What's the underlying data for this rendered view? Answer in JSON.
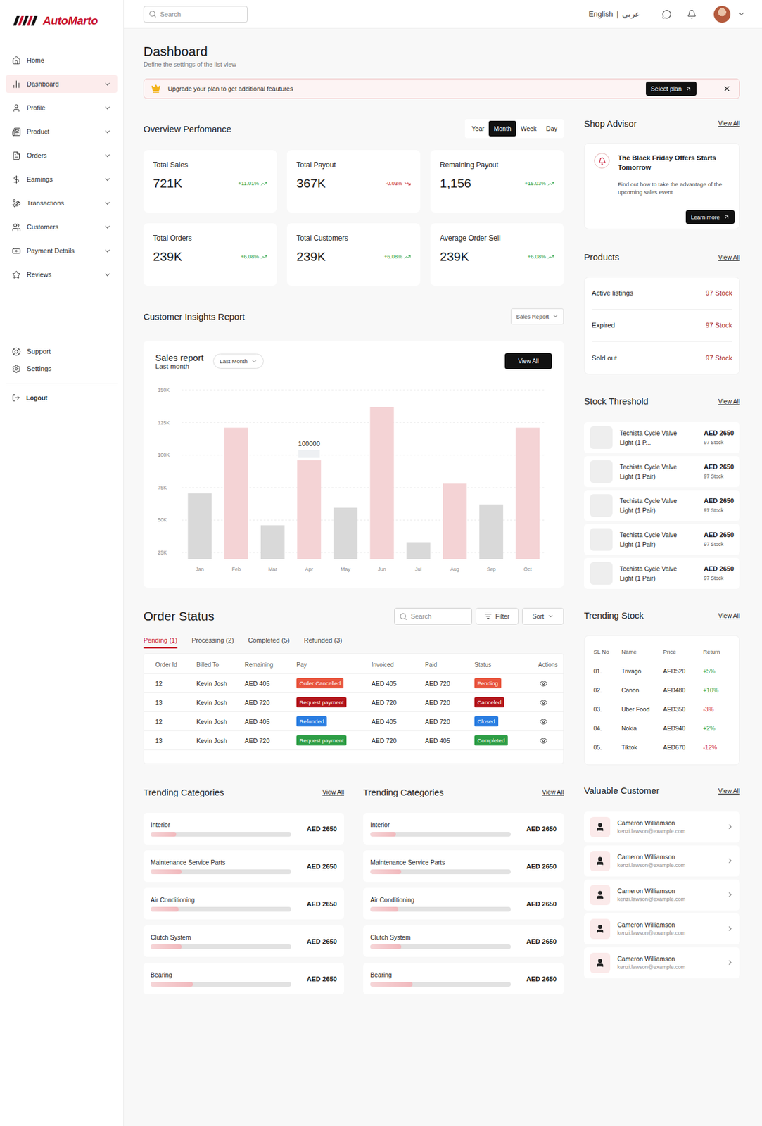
{
  "brand": {
    "name": "AutoMarto"
  },
  "topbar": {
    "search_placeholder": "Search",
    "language": "English",
    "separator": "|",
    "language_alt": "عربي"
  },
  "sidebar": {
    "items": [
      {
        "label": "Home",
        "expandable": false,
        "selected": false
      },
      {
        "label": "Dashboard",
        "expandable": true,
        "selected": true
      },
      {
        "label": "Profile",
        "expandable": true,
        "selected": false
      },
      {
        "label": "Product",
        "expandable": true,
        "selected": false
      },
      {
        "label": "Orders",
        "expandable": true,
        "selected": false
      },
      {
        "label": "Earnings",
        "expandable": true,
        "selected": false
      },
      {
        "label": "Transactions",
        "expandable": true,
        "selected": false
      },
      {
        "label": "Customers",
        "expandable": true,
        "selected": false
      },
      {
        "label": "Payment Details",
        "expandable": true,
        "selected": false
      },
      {
        "label": "Reviews",
        "expandable": true,
        "selected": false
      }
    ],
    "footer_items": [
      {
        "label": "Support"
      },
      {
        "label": "Settings"
      }
    ],
    "logout": "Logout"
  },
  "page": {
    "title": "Dashboard",
    "subtitle": "Define the settings of the list view"
  },
  "banner": {
    "text": "Upgrade your plan to get additional feautures",
    "button": "Select plan"
  },
  "overview": {
    "title": "Overview Perfomance",
    "periods": [
      {
        "label": "Year",
        "selected": false
      },
      {
        "label": "Month",
        "selected": true
      },
      {
        "label": "Week",
        "selected": false
      },
      {
        "label": "Day",
        "selected": false
      }
    ],
    "stats": [
      {
        "label": "Total Sales",
        "value": "721K",
        "change": "+11.01%",
        "kind": "up",
        "color": "#1f9d3a"
      },
      {
        "label": "Total Payout",
        "value": "367K",
        "change": "-0.03%",
        "kind": "down",
        "color": "#c0151b"
      },
      {
        "label": "Remaining Payout",
        "value": "1,156",
        "change": "+15.03%",
        "kind": "up",
        "color": "#1f9d3a"
      },
      {
        "label": "Total Orders",
        "value": "239K",
        "change": "+6.08%",
        "kind": "up",
        "color": "#1f9d3a"
      },
      {
        "label": "Total Customers",
        "value": "239K",
        "change": "+6.08%",
        "kind": "up",
        "color": "#1f9d3a"
      },
      {
        "label": "Average Order Sell",
        "value": "239K",
        "change": "+6.08%",
        "kind": "up",
        "color": "#1f9d3a"
      }
    ]
  },
  "insights": {
    "title": "Customer Insights Report",
    "dropdown": "Sales Report",
    "chart": {
      "title": "Sales report",
      "subtitle": "Last month",
      "range": "Last Month",
      "button": "View All",
      "y_ticks": [
        {
          "label": "150K",
          "value": 150000
        },
        {
          "label": "125K",
          "value": 125000
        },
        {
          "label": "100K",
          "value": 100000
        },
        {
          "label": "75K",
          "value": 75000
        },
        {
          "label": "50K",
          "value": 50000
        },
        {
          "label": "25K",
          "value": 25000
        }
      ],
      "bars": [
        {
          "month": "Jan",
          "value": 70600,
          "color": "#d9d9d9"
        },
        {
          "month": "Feb",
          "value": 121000,
          "color": "#f4d3d5"
        },
        {
          "month": "Mar",
          "value": 46000,
          "color": "#d9d9d9"
        },
        {
          "month": "Apr",
          "value": 96000,
          "color": "#f4d3d5"
        },
        {
          "month": "May",
          "value": 59500,
          "color": "#d9d9d9"
        },
        {
          "month": "Jun",
          "value": 136700,
          "color": "#f4d3d5"
        },
        {
          "month": "Jul",
          "value": 33000,
          "color": "#d9d9d9"
        },
        {
          "month": "Aug",
          "value": 78000,
          "color": "#f4d3d5"
        },
        {
          "month": "Sep",
          "value": 62000,
          "color": "#d9d9d9"
        },
        {
          "month": "Oct",
          "value": 121000,
          "color": "#f4d3d5"
        }
      ],
      "tooltip": {
        "month": "Apr",
        "label": "100000"
      }
    }
  },
  "order_status": {
    "title": "Order Status",
    "search_placeholder": "Search",
    "filter": "Filter",
    "sort": "Sort",
    "tabs": [
      {
        "label": "Pending (1)",
        "selected": true
      },
      {
        "label": "Processing (2)",
        "selected": false
      },
      {
        "label": "Completed (5)",
        "selected": false
      },
      {
        "label": "Refunded (3)",
        "selected": false
      }
    ],
    "columns": [
      "Order Id",
      "Billed To",
      "Remaining",
      "Pay",
      "Invoiced",
      "Paid",
      "Status",
      "Actions"
    ],
    "rows": [
      {
        "order_id": "12",
        "billed_to": "Kevin Josh",
        "remaining": "AED 405",
        "pay": {
          "label": "Order Cancelled",
          "color": "#e8553e"
        },
        "invoiced": "AED 405",
        "paid": "AED 720",
        "status": {
          "label": "Pending",
          "color": "#e8553e"
        }
      },
      {
        "order_id": "13",
        "billed_to": "Kevin Josh",
        "remaining": "AED 720",
        "pay": {
          "label": "Request payment",
          "color": "#b3161b"
        },
        "invoiced": "AED 720",
        "paid": "AED 720",
        "status": {
          "label": "Canceled",
          "color": "#b3161b"
        }
      },
      {
        "order_id": "12",
        "billed_to": "Kevin Josh",
        "remaining": "AED 405",
        "pay": {
          "label": "Refunded",
          "color": "#2a7de1"
        },
        "invoiced": "AED 405",
        "paid": "AED 720",
        "status": {
          "label": "Closed",
          "color": "#2a7de1"
        }
      },
      {
        "order_id": "13",
        "billed_to": "Kevin Josh",
        "remaining": "AED 720",
        "pay": {
          "label": "Request payment",
          "color": "#2e9e46"
        },
        "invoiced": "AED 720",
        "paid": "AED 405",
        "status": {
          "label": "Completed",
          "color": "#2e9e46"
        }
      }
    ]
  },
  "trending_categories": [
    {
      "title": "Trending Categories",
      "view_all": "View All",
      "items": [
        {
          "name": "Interior",
          "price": "AED 2650",
          "level": 0.18
        },
        {
          "name": "Maintenance Service Parts",
          "price": "AED 2650",
          "level": 0.22
        },
        {
          "name": "Air Conditioning",
          "price": "AED 2650",
          "level": 0.2
        },
        {
          "name": "Clutch System",
          "price": "AED 2650",
          "level": 0.22
        },
        {
          "name": "Bearing",
          "price": "AED 2650",
          "level": 0.3
        }
      ]
    },
    {
      "title": "Trending Categories",
      "view_all": "View All",
      "items": [
        {
          "name": "Interior",
          "price": "AED 2650",
          "level": 0.18
        },
        {
          "name": "Maintenance Service Parts",
          "price": "AED 2650",
          "level": 0.22
        },
        {
          "name": "Air Conditioning",
          "price": "AED 2650",
          "level": 0.2
        },
        {
          "name": "Clutch System",
          "price": "AED 2650",
          "level": 0.22
        },
        {
          "name": "Bearing",
          "price": "AED 2650",
          "level": 0.3
        }
      ]
    }
  ],
  "shop_advisor": {
    "title": "Shop Advisor",
    "view_all": "View All",
    "headline": "The Black Friday Offers Starts Tomorrow",
    "text": "Find out how to take the advantage of the upcoming sales event",
    "button": "Learn more"
  },
  "products": {
    "title": "Products",
    "view_all": "View All",
    "rows": [
      {
        "label": "Active listings",
        "stock": "97 Stock"
      },
      {
        "label": "Expired",
        "stock": "97 Stock"
      },
      {
        "label": "Sold out",
        "stock": "97 Stock"
      }
    ]
  },
  "stock_threshold": {
    "title": "Stock Threshold",
    "view_all": "View All",
    "items": [
      {
        "name": "Techista Cycle Valve Light (1 P...",
        "price": "AED 2650",
        "stock": "97 Stock"
      },
      {
        "name": "Techista Cycle Valve Light (1 Pair)",
        "price": "AED 2650",
        "stock": "97 Stock"
      },
      {
        "name": "Techista Cycle Valve Light (1 Pair)",
        "price": "AED 2650",
        "stock": "97 Stock"
      },
      {
        "name": "Techista Cycle Valve Light (1 Pair)",
        "price": "AED 2650",
        "stock": "97 Stock"
      },
      {
        "name": "Techista Cycle Valve Light (1 Pair)",
        "price": "AED 2650",
        "stock": "97 Stock"
      }
    ]
  },
  "trending_stock": {
    "title": "Trending Stock",
    "view_all": "View All",
    "columns": [
      "SL No",
      "Name",
      "Price",
      "Return"
    ],
    "rows": [
      {
        "no": "01.",
        "name": "Trivago",
        "price": "AED520",
        "return": "+5%",
        "color": "#1f9d3a"
      },
      {
        "no": "02.",
        "name": "Canon",
        "price": "AED480",
        "return": "+10%",
        "color": "#1f9d3a"
      },
      {
        "no": "03.",
        "name": "Uber Food",
        "price": "AED350",
        "return": "-3%",
        "color": "#d0262c"
      },
      {
        "no": "04.",
        "name": "Nokia",
        "price": "AED940",
        "return": "+2%",
        "color": "#1f9d3a"
      },
      {
        "no": "05.",
        "name": "Tiktok",
        "price": "AED670",
        "return": "-12%",
        "color": "#d0262c"
      }
    ]
  },
  "valuable_customer": {
    "title": "Valuable Customer",
    "view_all": "View All",
    "items": [
      {
        "name": "Cameron Williamson",
        "email": "kenzi.lawson@example.com"
      },
      {
        "name": "Cameron Williamson",
        "email": "kenzi.lawson@example.com"
      },
      {
        "name": "Cameron Williamson",
        "email": "kenzi.lawson@example.com"
      },
      {
        "name": "Cameron Williamson",
        "email": "kenzi.lawson@example.com"
      },
      {
        "name": "Cameron Williamson",
        "email": "kenzi.lawson@example.com"
      }
    ]
  }
}
